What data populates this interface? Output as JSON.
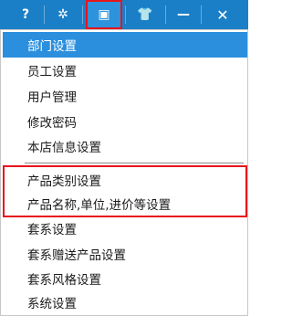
{
  "toolbar": {
    "buttons": [
      {
        "icon": "help-icon",
        "glyph": "?"
      },
      {
        "icon": "gear-icon",
        "glyph": "✲"
      },
      {
        "icon": "report-icon",
        "glyph": "▣"
      },
      {
        "icon": "shirt-icon",
        "glyph": "👕"
      },
      {
        "icon": "minimize-icon",
        "glyph": "—"
      },
      {
        "icon": "close-icon",
        "glyph": "✕"
      }
    ],
    "highlight_color": "#e8141b",
    "background": "#1b7fc8"
  },
  "menu": {
    "items": [
      {
        "label": "部门设置",
        "active": true
      },
      {
        "label": "员工设置"
      },
      {
        "label": "用户管理"
      },
      {
        "label": "修改密码"
      },
      {
        "label": "本店信息设置"
      },
      {
        "label": "产品类别设置"
      },
      {
        "label": "产品名称,单位,进价等设置"
      },
      {
        "label": "套系设置"
      },
      {
        "label": "套系赠送产品设置"
      },
      {
        "label": "套系风格设置"
      },
      {
        "label": "系统设置"
      }
    ],
    "active_color": "#2b8fde"
  }
}
